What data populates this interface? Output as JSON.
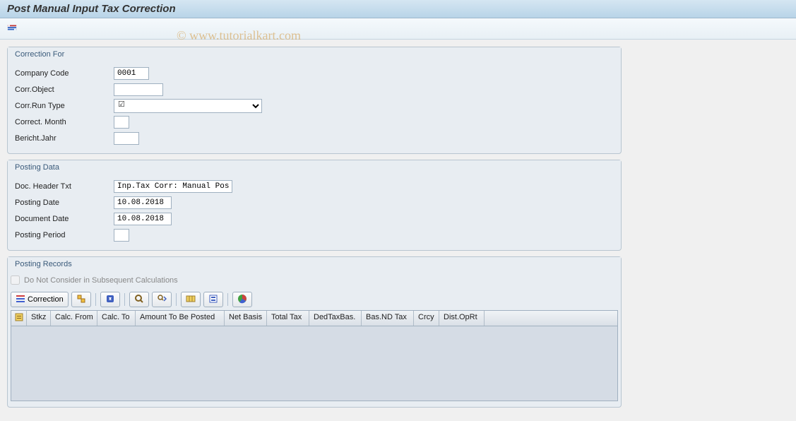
{
  "header": {
    "title": "Post Manual Input Tax Correction"
  },
  "watermark": "© www.tutorialkart.com",
  "groups": {
    "correction_for": {
      "title": "Correction For",
      "fields": {
        "company_code": {
          "label": "Company Code",
          "value": "0001"
        },
        "corr_object": {
          "label": "Corr.Object",
          "value": ""
        },
        "corr_run_type": {
          "label": "Corr.Run Type",
          "value": ""
        },
        "correct_month": {
          "label": "Correct. Month",
          "value": ""
        },
        "bericht_jahr": {
          "label": "Bericht.Jahr",
          "value": ""
        }
      }
    },
    "posting_data": {
      "title": "Posting Data",
      "fields": {
        "doc_header_txt": {
          "label": "Doc. Header Txt",
          "value": "Inp.Tax Corr: Manual Post"
        },
        "posting_date": {
          "label": "Posting Date",
          "value": "10.08.2018"
        },
        "document_date": {
          "label": "Document Date",
          "value": "10.08.2018"
        },
        "posting_period": {
          "label": "Posting Period",
          "value": ""
        }
      }
    },
    "posting_records": {
      "title": "Posting Records",
      "checkbox_label": "Do Not Consider in Subsequent Calculations",
      "toolbar": {
        "correction_label": "Correction"
      },
      "columns": [
        "Stkz",
        "Calc. From",
        "Calc. To",
        "Amount To Be Posted",
        "Net Basis",
        "Total Tax",
        "DedTaxBas.",
        "Bas.ND Tax",
        "Crcy",
        "Dist.OpRt"
      ]
    }
  }
}
